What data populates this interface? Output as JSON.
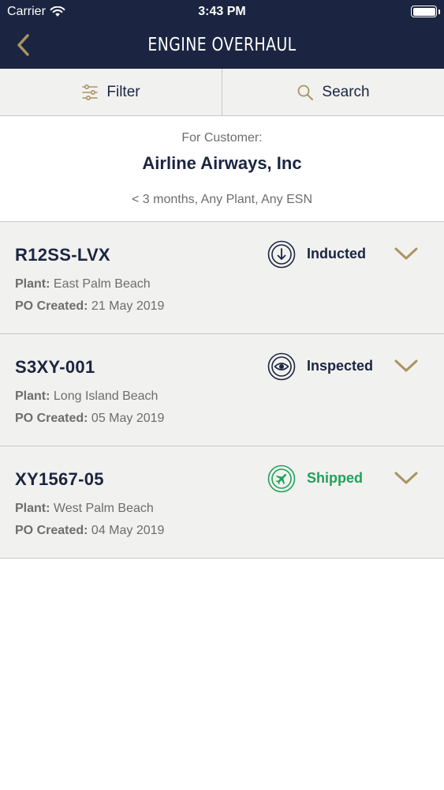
{
  "status_bar": {
    "carrier": "Carrier",
    "time": "3:43 PM"
  },
  "nav": {
    "title": "ENGINE OVERHAUL"
  },
  "toolbar": {
    "filter_label": "Filter",
    "search_label": "Search"
  },
  "customer": {
    "label": "For Customer:",
    "name": "Airline Airways, Inc",
    "filter_summary": "< 3 months, Any Plant, Any ESN"
  },
  "meta_labels": {
    "plant": "Plant:",
    "po_created": "PO Created:"
  },
  "orders": [
    {
      "id": "R12SS-LVX",
      "status": "Inducted",
      "status_icon": "arrow-down-circle-icon",
      "plant": "East Palm Beach",
      "po_created": "21 May 2019"
    },
    {
      "id": "S3XY-001",
      "status": "Inspected",
      "status_icon": "eye-circle-icon",
      "plant": "Long Island Beach",
      "po_created": "05 May 2019"
    },
    {
      "id": "XY1567-05",
      "status": "Shipped",
      "status_icon": "airplane-circle-icon",
      "plant": "West Palm Beach",
      "po_created": "04 May 2019"
    }
  ],
  "colors": {
    "navy": "#1b2541",
    "gold": "#a99461",
    "shipped_green": "#1fa25a",
    "muted_text": "#6d6d6d",
    "row_bg": "#f1f1ef"
  }
}
